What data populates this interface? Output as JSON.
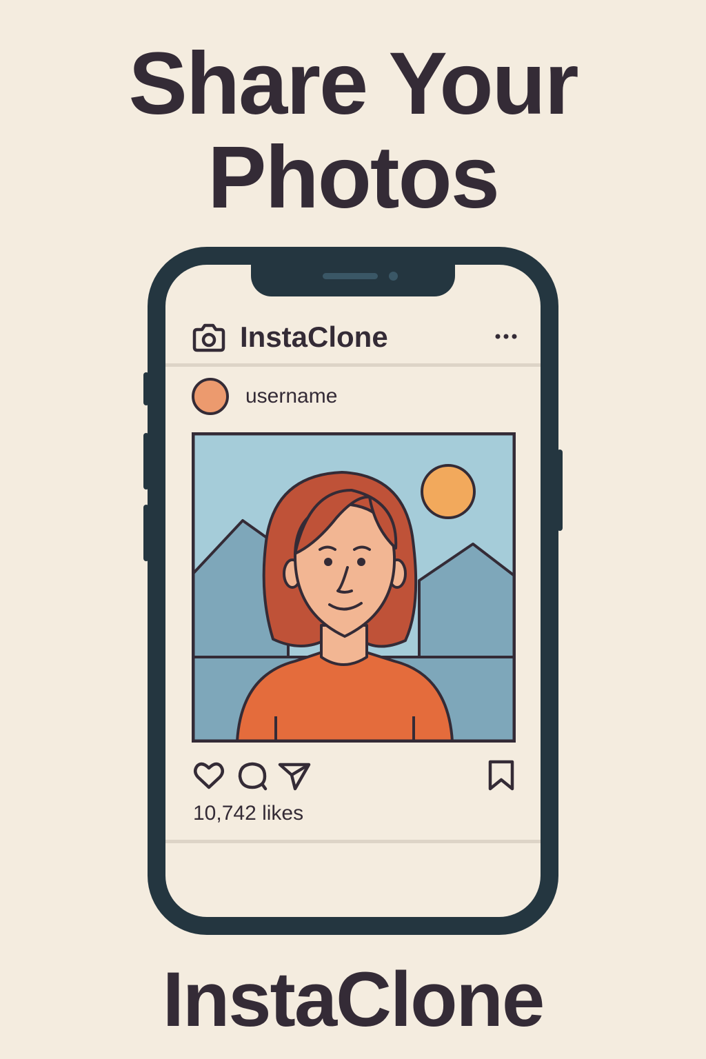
{
  "poster": {
    "headline_line1": "Share Your",
    "headline_line2": "Photos",
    "footer_brand": "InstaClone"
  },
  "app": {
    "title": "InstaClone",
    "logo_icon": "camera-icon",
    "menu_icon": "more-horizontal-icon"
  },
  "post": {
    "username": "username",
    "likes_text": "10,742 likes",
    "photo_subject": "smiling-woman-illustration",
    "actions": [
      "heart-icon",
      "comment-icon",
      "send-icon",
      "bookmark-icon"
    ]
  },
  "colors": {
    "background": "#f4ecdf",
    "ink": "#342b36",
    "phone_frame": "#243640",
    "avatar": "#ec9a6e",
    "sky": "#a5ccd9",
    "mountains": "#7ea7ba",
    "sun": "#f2a95c",
    "hair": "#bf5238",
    "skin": "#f2b693",
    "shirt": "#e46c3c"
  }
}
